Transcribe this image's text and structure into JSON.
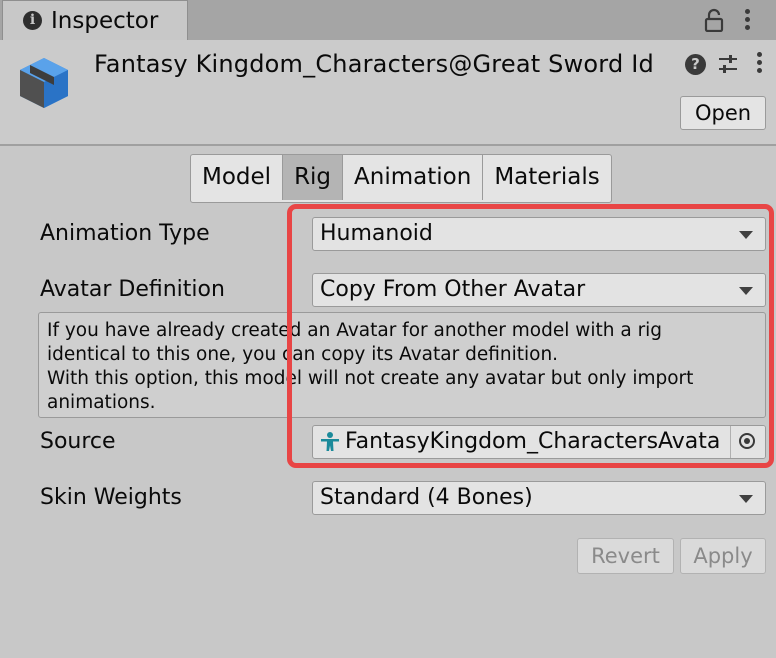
{
  "window": {
    "tab_title": "Inspector"
  },
  "header": {
    "asset_name": "Fantasy Kingdom_Characters@Great Sword Id",
    "open_label": "Open"
  },
  "tabs": [
    {
      "label": "Model",
      "active": false
    },
    {
      "label": "Rig",
      "active": true
    },
    {
      "label": "Animation",
      "active": false
    },
    {
      "label": "Materials",
      "active": false
    }
  ],
  "fields": {
    "animation_type": {
      "label": "Animation Type",
      "value": "Humanoid"
    },
    "avatar_definition": {
      "label": "Avatar Definition",
      "value": "Copy From Other Avatar"
    },
    "help_lines": [
      "If you have already created an Avatar for another model with a rig",
      "identical to this one, you can copy its Avatar definition.",
      "With this option, this model will not create any avatar but only import",
      "animations."
    ],
    "source": {
      "label": "Source",
      "value": "FantasyKingdom_CharactersAvata"
    },
    "skin_weights": {
      "label": "Skin Weights",
      "value": "Standard (4 Bones)"
    }
  },
  "actions": {
    "revert_label": "Revert",
    "apply_label": "Apply"
  },
  "colors": {
    "highlight": "#e84545",
    "asset_icon": "#2f7fd6",
    "avatar_icon": "#1b8a9a"
  },
  "icons": [
    "info-icon",
    "lock-icon",
    "kebab-menu-icon",
    "asset-cube-icon",
    "help-icon",
    "preset-sliders-icon",
    "avatar-icon",
    "object-picker-icon",
    "dropdown-arrow-icon"
  ]
}
